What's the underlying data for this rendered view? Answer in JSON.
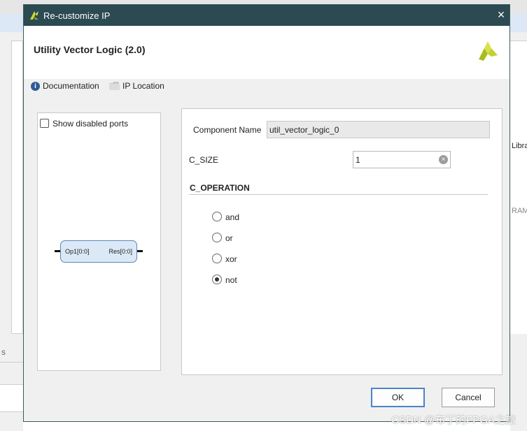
{
  "window": {
    "title": "Re-customize IP",
    "close_label": "×"
  },
  "header": {
    "ip_title": "Utility Vector Logic (2.0)",
    "documentation_label": "Documentation",
    "ip_location_label": "IP Location"
  },
  "left_panel": {
    "show_disabled_ports_label": "Show disabled ports",
    "block": {
      "input_port": "Op1[0:0]",
      "output_port": "Res[0:0]"
    }
  },
  "form": {
    "component_name_label": "Component Name",
    "component_name_value": "util_vector_logic_0",
    "c_size_label": "C_SIZE",
    "c_size_value": "1",
    "c_operation_label": "C_OPERATION",
    "operations": [
      "and",
      "or",
      "xor",
      "not"
    ],
    "selected_operation": "not"
  },
  "buttons": {
    "ok": "OK",
    "cancel": "Cancel"
  },
  "background": {
    "right_text_top": "Librar",
    "right_text_bottom": "RAM",
    "tab_text": "s"
  },
  "watermark": "CSDN @布丁的FPGA之旅",
  "colors": {
    "titlebar": "#2b4a52",
    "accent": "#4a84c8",
    "green_row": "#c9f0c1"
  }
}
